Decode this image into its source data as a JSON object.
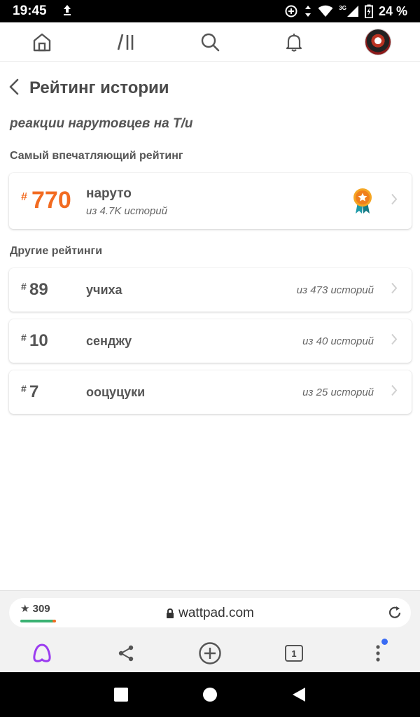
{
  "status_bar": {
    "time": "19:45",
    "signal_label": "3G",
    "battery_text": "24 %"
  },
  "page": {
    "title": "Рейтинг истории",
    "story_title": "реакции нарутовцев на Т/и"
  },
  "top_section": {
    "label": "Самый впечатляющий рейтинг",
    "hash": "#",
    "rank": "770",
    "tag": "наруто",
    "count": "из 4.7K историй"
  },
  "other_section": {
    "label": "Другие рейтинги",
    "items": [
      {
        "hash": "#",
        "rank": "89",
        "tag": "учиха",
        "count": "из 473 историй"
      },
      {
        "hash": "#",
        "rank": "10",
        "tag": "сенджу",
        "count": "из 40 историй"
      },
      {
        "hash": "#",
        "rank": "7",
        "tag": "ооцуцуки",
        "count": "из 25 историй"
      }
    ]
  },
  "browser": {
    "rating": "309",
    "url": "wattpad.com",
    "tab_count": "1"
  },
  "colors": {
    "accent": "#f26b21",
    "rating_green": "#3bb273",
    "assistant_purple": "#9b3cf0",
    "badge_blue": "#3a6cf4"
  },
  "icons": [
    "upload-icon",
    "data-saver-icon",
    "wifi-icon",
    "signal-icon",
    "battery-icon",
    "home-icon",
    "library-icon",
    "search-icon",
    "bell-icon",
    "back-icon",
    "medal-icon",
    "chevron-right-icon",
    "star-icon",
    "lock-icon",
    "reload-icon",
    "alice-icon",
    "share-icon",
    "add-icon",
    "tabs-icon",
    "menu-dots-icon",
    "recents-icon",
    "home-circle-icon",
    "back-triangle-icon"
  ]
}
